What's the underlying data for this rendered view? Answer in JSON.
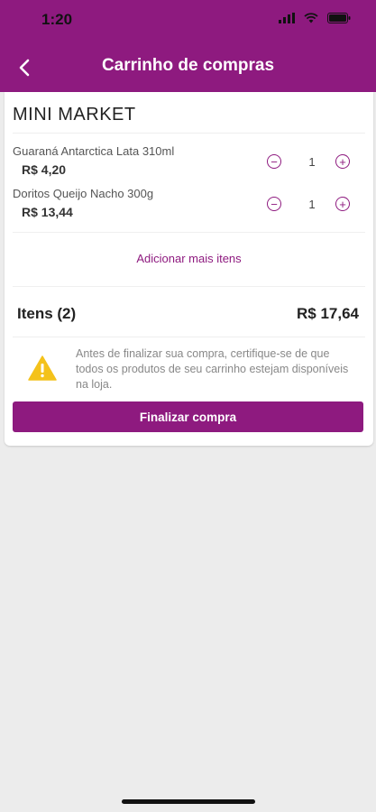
{
  "status": {
    "time": "1:20"
  },
  "header": {
    "title": "Carrinho de compras"
  },
  "store": {
    "name": "MINI MARKET"
  },
  "items": [
    {
      "name": "Guaraná Antarctica Lata 310ml",
      "price": "R$ 4,20",
      "qty": "1"
    },
    {
      "name": "Doritos Queijo Nacho 300g",
      "price": "R$ 13,44",
      "qty": "1"
    }
  ],
  "add_more": "Adicionar mais itens",
  "summary": {
    "label": "Itens (2)",
    "total": "R$ 17,64"
  },
  "warning": {
    "text": "Antes de finalizar sua compra, certifique-se de que todos os produtos de seu carrinho estejam disponíveis na loja."
  },
  "finalize": {
    "label": "Finalizar compra"
  },
  "colors": {
    "brand": "#8e1a7f",
    "warning": "#f4c21b",
    "background": "#ececec"
  }
}
